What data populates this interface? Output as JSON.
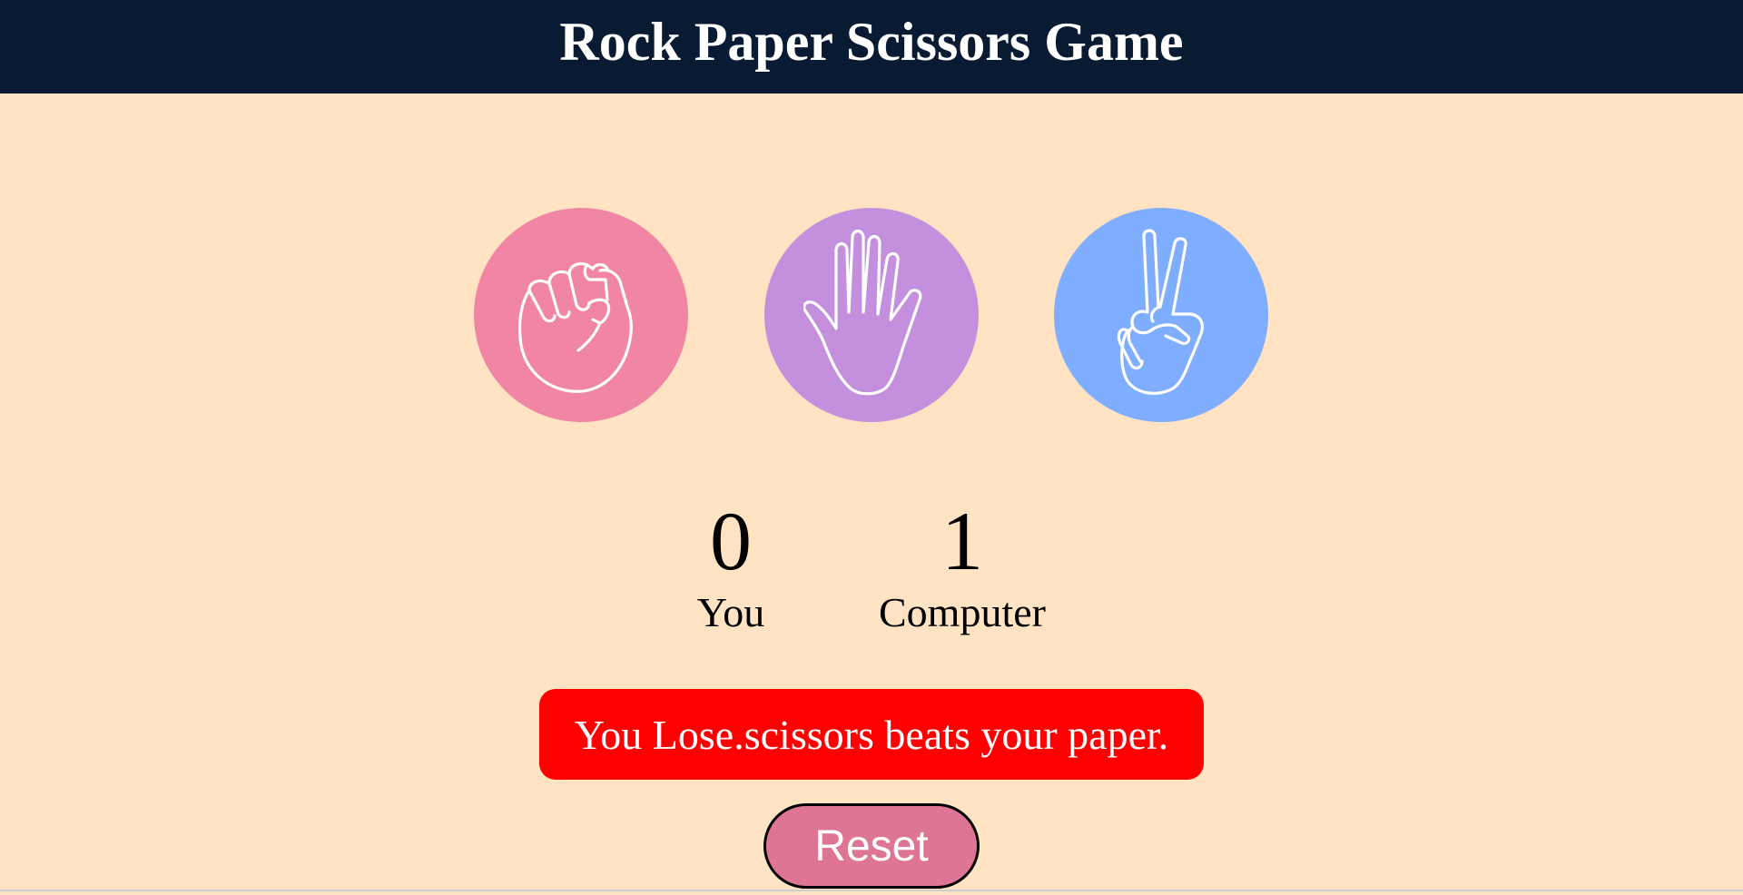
{
  "header": {
    "title": "Rock Paper Scissors Game"
  },
  "choices": [
    {
      "id": "rock",
      "icon": "fist-icon",
      "color": "#f086a4"
    },
    {
      "id": "paper",
      "icon": "open-hand-icon",
      "color": "#c490de"
    },
    {
      "id": "scissors",
      "icon": "peace-hand-icon",
      "color": "#7fadff"
    }
  ],
  "scoreboard": {
    "user": {
      "score": "0",
      "label": "You"
    },
    "computer": {
      "score": "1",
      "label": "Computer"
    }
  },
  "message": {
    "text": "You Lose.scissors beats your paper.",
    "color": "#ff0000"
  },
  "reset": {
    "label": "Reset",
    "color": "#df7595"
  },
  "colors": {
    "header_bg": "#081b33",
    "page_bg": "#ffe3c2"
  }
}
